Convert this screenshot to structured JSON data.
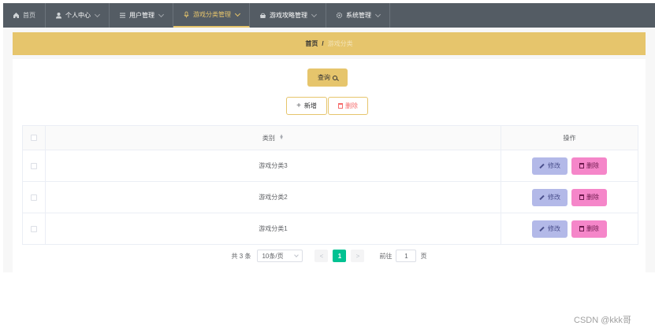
{
  "nav": {
    "items": [
      {
        "label": "首页",
        "icon": "home-icon"
      },
      {
        "label": "个人中心",
        "icon": "user-icon"
      },
      {
        "label": "用户管理",
        "icon": "list-icon"
      },
      {
        "label": "游戏分类管理",
        "icon": "category-icon",
        "active": true
      },
      {
        "label": "游戏攻略管理",
        "icon": "guide-icon"
      },
      {
        "label": "系统管理",
        "icon": "gear-icon"
      }
    ]
  },
  "breadcrumb": {
    "home": "首页",
    "separator": "/",
    "current": "游戏分类"
  },
  "toolbar": {
    "query_label": "查询",
    "add_label": "新增",
    "delete_label": "删除"
  },
  "table": {
    "columns": {
      "category": "类别",
      "actions": "操作"
    },
    "rows": [
      {
        "category": "游戏分类3",
        "edit": "修改",
        "delete": "删除"
      },
      {
        "category": "游戏分类2",
        "edit": "修改",
        "delete": "删除"
      },
      {
        "category": "游戏分类1",
        "edit": "修改",
        "delete": "删除"
      }
    ]
  },
  "pagination": {
    "total_text": "共 3 条",
    "page_size": "10条/页",
    "prev": "<",
    "current_page": "1",
    "next": ">",
    "goto_label": "前往",
    "goto_value": "1",
    "goto_unit": "页"
  },
  "watermark": "CSDN @kkk哥",
  "colors": {
    "accent": "#e6c56c",
    "nav_bg": "#545c64",
    "edit_btn": "#b3b9e8",
    "delete_btn": "#f586c9",
    "page_active": "#00c292"
  }
}
